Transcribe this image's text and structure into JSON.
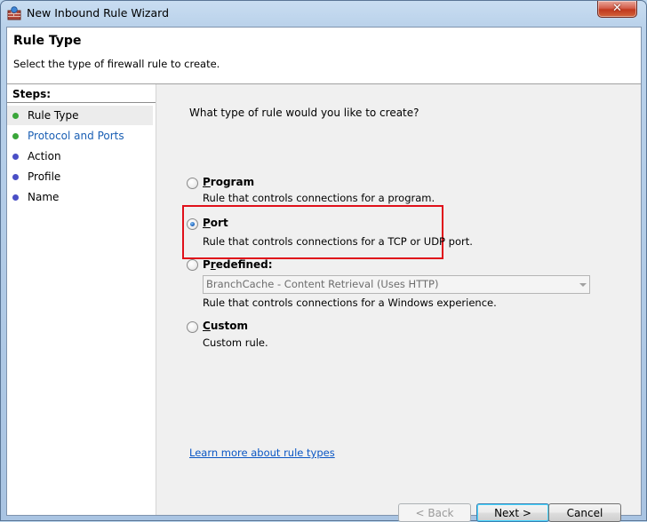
{
  "window": {
    "title": "New Inbound Rule Wizard",
    "close_glyph": "✕"
  },
  "header": {
    "title": "Rule Type",
    "subtitle": "Select the type of firewall rule to create."
  },
  "steps": {
    "title": "Steps:",
    "items": [
      {
        "label": "Rule Type",
        "status": "complete",
        "color": "#3aa63a"
      },
      {
        "label": "Protocol and Ports",
        "status": "complete",
        "color": "#3aa63a"
      },
      {
        "label": "Action",
        "status": "pending",
        "color": "#4a4fc6"
      },
      {
        "label": "Profile",
        "status": "pending",
        "color": "#4a4fc6"
      },
      {
        "label": "Name",
        "status": "pending",
        "color": "#4a4fc6"
      }
    ]
  },
  "main": {
    "question": "What type of rule would you like to create?",
    "options": [
      {
        "label": "Program",
        "mnemonic": "P",
        "rest": "rogram",
        "desc": "Rule that controls connections for a program.",
        "checked": false
      },
      {
        "label": "Port",
        "mnemonic": "P",
        "rest": "ort",
        "desc": "Rule that controls connections for a TCP or UDP port.",
        "checked": true
      },
      {
        "label": "Predefined:",
        "mnemonic": "r",
        "pre": "P",
        "rest": "edefined:",
        "desc": "Rule that controls connections for a Windows experience.",
        "checked": false
      },
      {
        "label": "Custom",
        "mnemonic": "C",
        "rest": "ustom",
        "desc": "Custom rule.",
        "checked": false
      }
    ],
    "predefined_select": {
      "value": "BranchCache - Content Retrieval (Uses HTTP)"
    },
    "learn_link": "Learn more about rule types"
  },
  "buttons": {
    "back": "< Back",
    "next": "Next >",
    "cancel": "Cancel"
  },
  "colors": {
    "highlight_box": "#e0101a",
    "link": "#0a56c4"
  }
}
